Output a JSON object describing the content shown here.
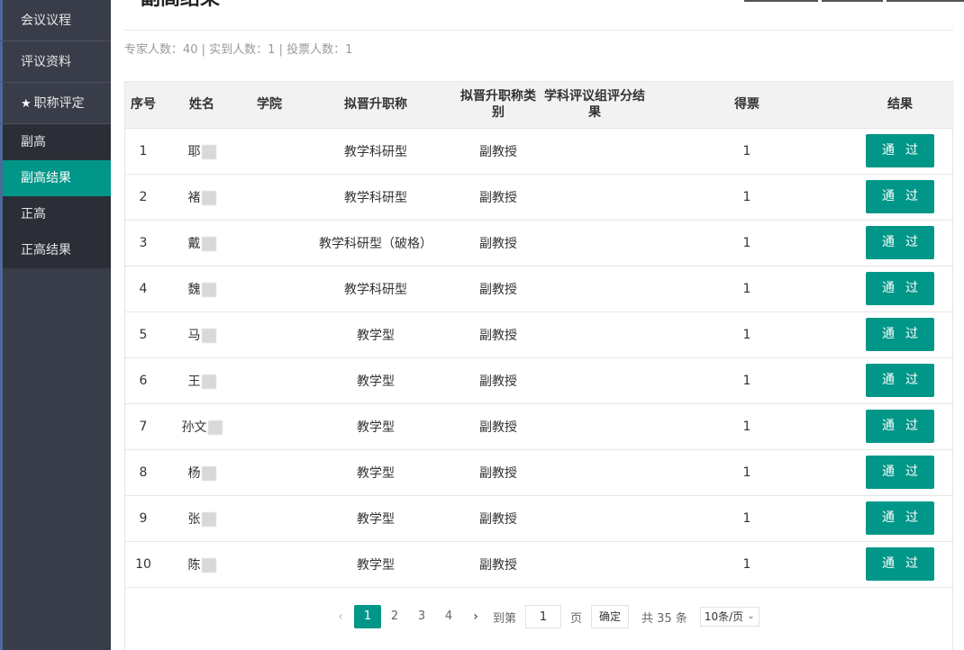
{
  "sidebar": {
    "items": [
      {
        "label": "会议议程"
      },
      {
        "label": "评议资料"
      },
      {
        "label": "职称评定"
      }
    ],
    "children": [
      {
        "label": "副高"
      },
      {
        "label": "副高结果"
      },
      {
        "label": "正高"
      },
      {
        "label": "正高结果"
      }
    ]
  },
  "page": {
    "title": "副高结果",
    "stats": "专家人数：40 | 实到人数：1 | 投票人数：1"
  },
  "table": {
    "headers": [
      "序号",
      "姓名",
      "学院",
      "拟晋升职称",
      "拟晋升职称类别",
      "学科评议组评分结果",
      "得票",
      "结果"
    ],
    "rows": [
      {
        "no": "1",
        "name": "耶",
        "college": "",
        "title": "教学科研型",
        "category": "副教授",
        "score": "",
        "votes": "1",
        "result": "通过"
      },
      {
        "no": "2",
        "name": "褚",
        "college": "",
        "title": "教学科研型",
        "category": "副教授",
        "score": "",
        "votes": "1",
        "result": "通过"
      },
      {
        "no": "3",
        "name": "戴",
        "college": "",
        "title": "教学科研型（破格）",
        "category": "副教授",
        "score": "",
        "votes": "1",
        "result": "通过"
      },
      {
        "no": "4",
        "name": "魏",
        "college": "",
        "title": "教学科研型",
        "category": "副教授",
        "score": "",
        "votes": "1",
        "result": "通过"
      },
      {
        "no": "5",
        "name": "马",
        "college": "",
        "title": "教学型",
        "category": "副教授",
        "score": "",
        "votes": "1",
        "result": "通过"
      },
      {
        "no": "6",
        "name": "王",
        "college": "",
        "title": "教学型",
        "category": "副教授",
        "score": "",
        "votes": "1",
        "result": "通过"
      },
      {
        "no": "7",
        "name": "孙文",
        "college": "",
        "title": "教学型",
        "category": "副教授",
        "score": "",
        "votes": "1",
        "result": "通过"
      },
      {
        "no": "8",
        "name": "杨",
        "college": "",
        "title": "教学型",
        "category": "副教授",
        "score": "",
        "votes": "1",
        "result": "通过"
      },
      {
        "no": "9",
        "name": "张",
        "college": "",
        "title": "教学型",
        "category": "副教授",
        "score": "",
        "votes": "1",
        "result": "通过"
      },
      {
        "no": "10",
        "name": "陈",
        "college": "",
        "title": "教学型",
        "category": "副教授",
        "score": "",
        "votes": "1",
        "result": "通过"
      }
    ]
  },
  "pager": {
    "pages": [
      "1",
      "2",
      "3",
      "4"
    ],
    "current": "1",
    "goto_label": "到第",
    "goto_value": "1",
    "page_unit": "页",
    "confirm": "确定",
    "total": "共 35 条",
    "page_size": "10条/页"
  },
  "colors": {
    "accent": "#009688",
    "sidebar": "#393d49",
    "sidebar_sub": "#2b2e37"
  }
}
